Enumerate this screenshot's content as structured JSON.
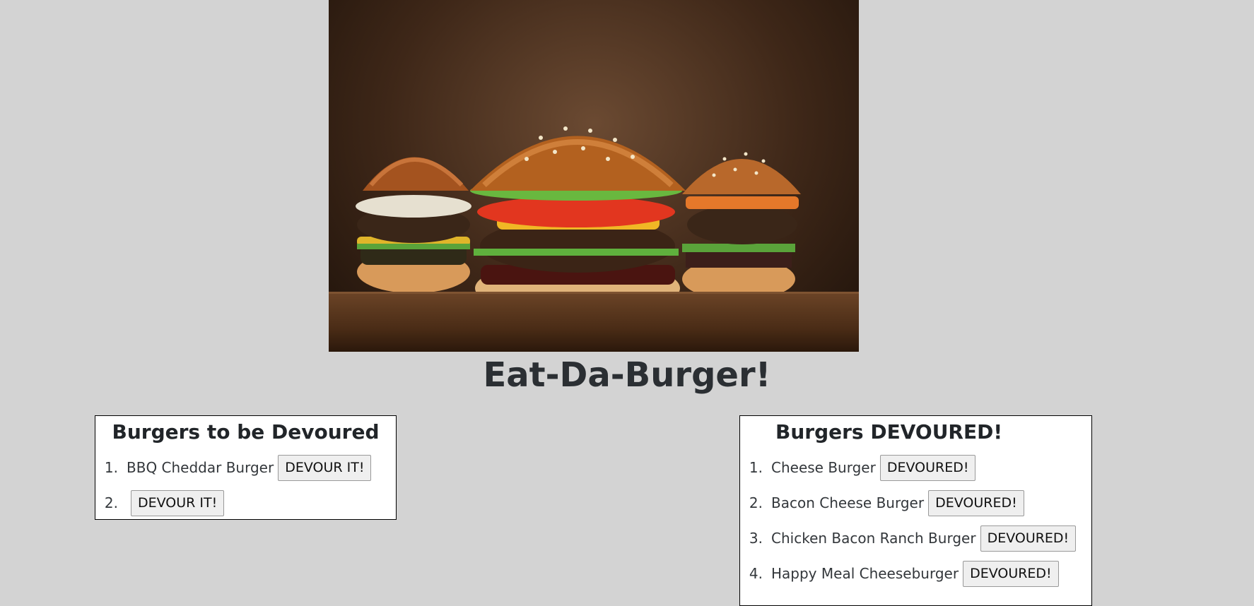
{
  "hero": {
    "image": "burgers-photo"
  },
  "page": {
    "title": "Eat-Da-Burger!"
  },
  "to_devour": {
    "heading": "Burgers to be Devoured",
    "items": [
      {
        "num": "1.",
        "name": "BBQ Cheddar Burger",
        "button": "DEVOUR IT!"
      },
      {
        "num": "2.",
        "name": "",
        "button": "DEVOUR IT!"
      }
    ]
  },
  "devoured": {
    "heading": "Burgers DEVOURED!",
    "items": [
      {
        "num": "1.",
        "name": "Cheese Burger",
        "button": "DEVOURED!"
      },
      {
        "num": "2.",
        "name": "Bacon Cheese Burger",
        "button": "DEVOURED!"
      },
      {
        "num": "3.",
        "name": "Chicken Bacon Ranch Burger",
        "button": "DEVOURED!"
      },
      {
        "num": "4.",
        "name": "Happy Meal Cheeseburger",
        "button": "DEVOURED!"
      }
    ]
  }
}
